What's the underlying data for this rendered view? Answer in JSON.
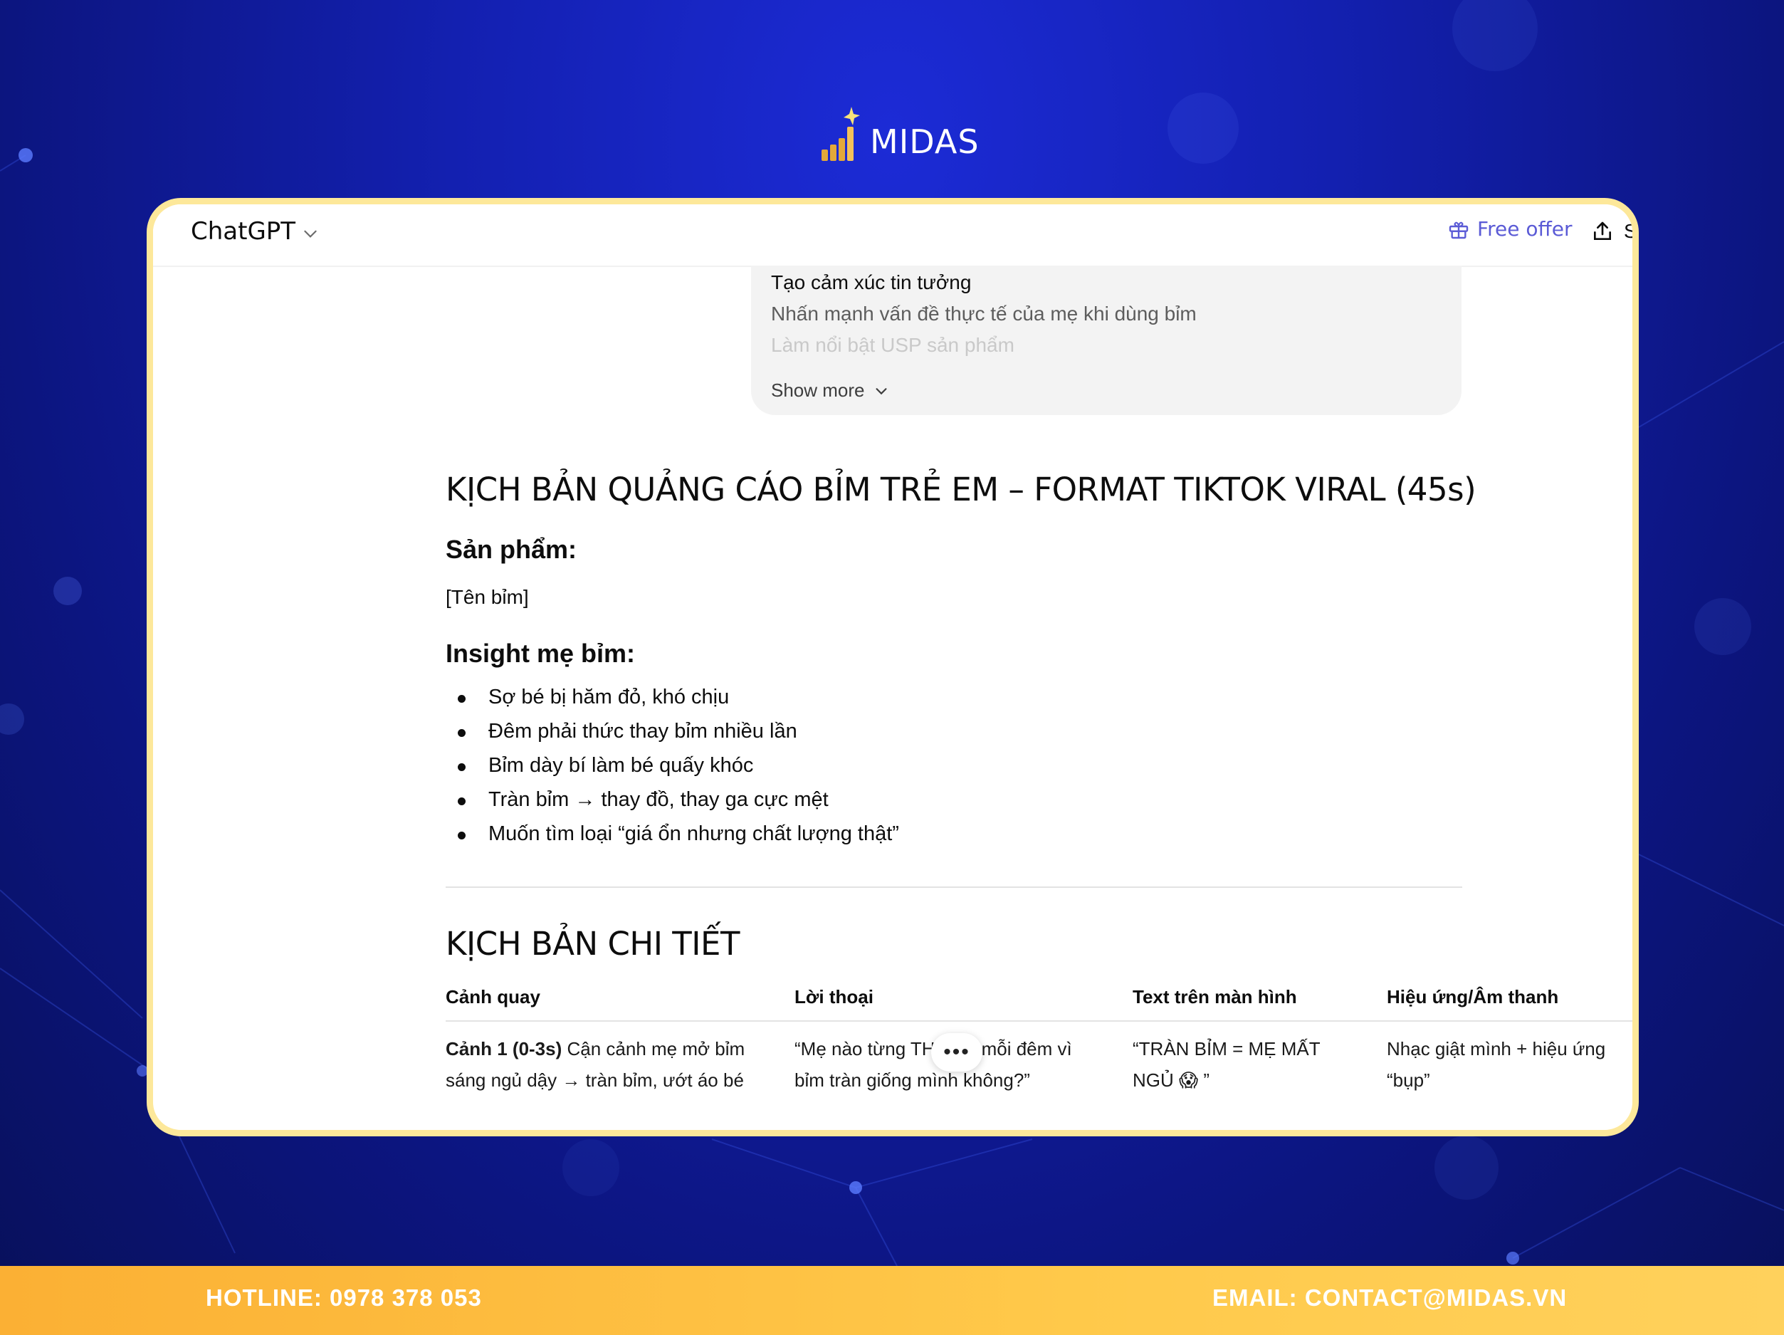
{
  "brand": {
    "logo_text": "MIDAS",
    "accent": "#fde89a",
    "background": "#1320b0",
    "footer_color": "#fbb034"
  },
  "chat": {
    "model_name": "ChatGPT",
    "free_offer_label": "Free offer",
    "share_label": "S",
    "quoted_message": {
      "lines": [
        "Tạo cảm xúc tin tưởng",
        "Nhấn mạnh vấn đề thực tế của mẹ khi dùng bỉm",
        "Làm nổi bật USP sản phẩm"
      ],
      "show_more_label": "Show more"
    },
    "answer": {
      "title": "KỊCH BẢN QUẢNG CÁO BỈM TRẺ EM – FORMAT TIKTOK VIRAL (45s)",
      "product_heading": "Sản phẩm:",
      "product_value": "[Tên bỉm]",
      "insight_heading": "Insight mẹ bỉm:",
      "insights": [
        "Sợ bé bị hăm đỏ, khó chịu",
        "Đêm phải thức thay bỉm nhiều lần",
        "Bỉm dày bí làm bé quấy khóc",
        "Tràn bỉm → thay đồ, thay ga cực mệt",
        "Muốn tìm loại “giá ổn nhưng chất lượng thật”"
      ],
      "detail_heading": "KỊCH BẢN CHI TIẾT",
      "table": {
        "headers": [
          "Cảnh quay",
          "Lời thoại",
          "Text trên màn hình",
          "Hiệu ứng/Âm thanh"
        ],
        "row1": {
          "scene_label": "Cảnh 1 (0-3s)",
          "scene_text": "Cận cảnh mẹ mở bỉm sáng ngủ dậy → tràn bỉm, ướt áo bé",
          "dialogue": "“Mẹ nào từng TH LẦN mỗi đêm vì bỉm tràn giống mình không?”",
          "screen_text": "“TRÀN BỈM = MẸ MẤT NGỦ 😱 ”",
          "effect": "Nhạc giật mình + hiệu ứng “bụp”"
        }
      }
    }
  },
  "footer": {
    "hotline": "HOTLINE: 0978 378 053",
    "email": "EMAIL: CONTACT@MIDAS.VN"
  }
}
